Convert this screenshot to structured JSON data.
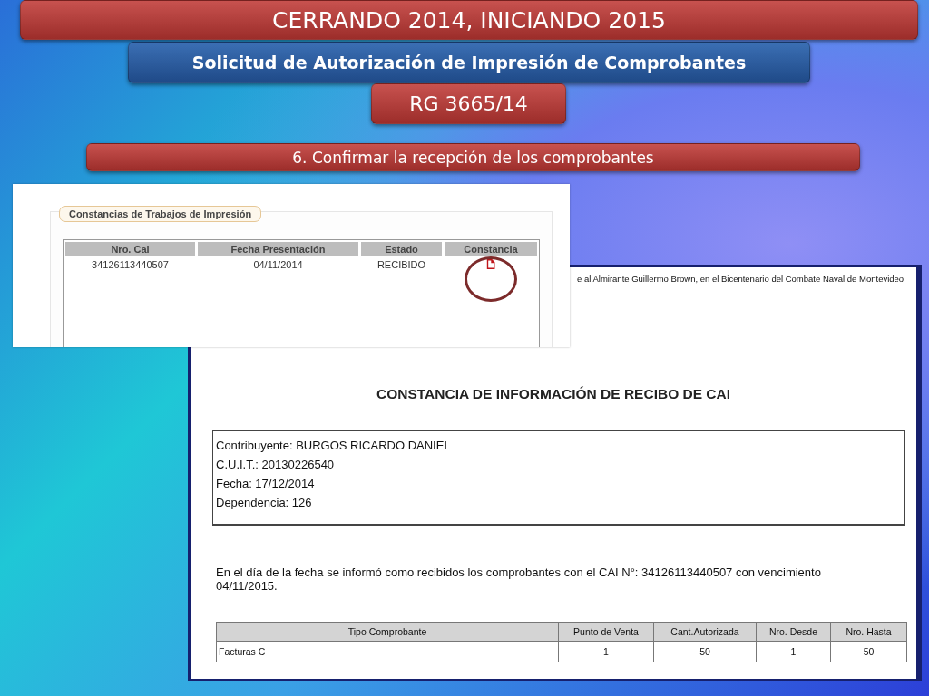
{
  "slide": {
    "title": "CERRANDO 2014, INICIANDO 2015",
    "subtitle": "Solicitud de Autorización de Impresión de Comprobantes",
    "resolution": "RG 3665/14",
    "step": "6. Confirmar la recepción de los comprobantes"
  },
  "list_screenshot": {
    "section_title": "Constancias de Trabajos de Impresión",
    "columns": [
      "Nro. Cai",
      "Fecha Presentación",
      "Estado",
      "Constancia"
    ],
    "rows": [
      {
        "nro_cai": "34126113440507",
        "fecha_presentacion": "04/11/2014",
        "estado": "RECIBIDO"
      }
    ]
  },
  "document_screenshot": {
    "header_text": "e al Almirante Guillermo Brown, en el Bicentenario del Combate Naval de Montevideo",
    "title": "CONSTANCIA DE INFORMACIÓN DE RECIBO DE CAI",
    "fields": [
      "Contribuyente: BURGOS RICARDO DANIEL",
      "C.U.I.T.: 20130226540",
      "Fecha: 17/12/2014",
      "Dependencia: 126"
    ],
    "statement": "En el día de la fecha se informó como recibidos los comprobantes con el CAI N°: 34126113440507  con vencimiento 04/11/2015.",
    "columns": [
      "Tipo Comprobante",
      "Punto de Venta",
      "Cant.Autorizada",
      "Nro. Desde",
      "Nro. Hasta"
    ],
    "rows": [
      [
        "Facturas C",
        "1",
        "50",
        "1",
        "50"
      ]
    ]
  }
}
